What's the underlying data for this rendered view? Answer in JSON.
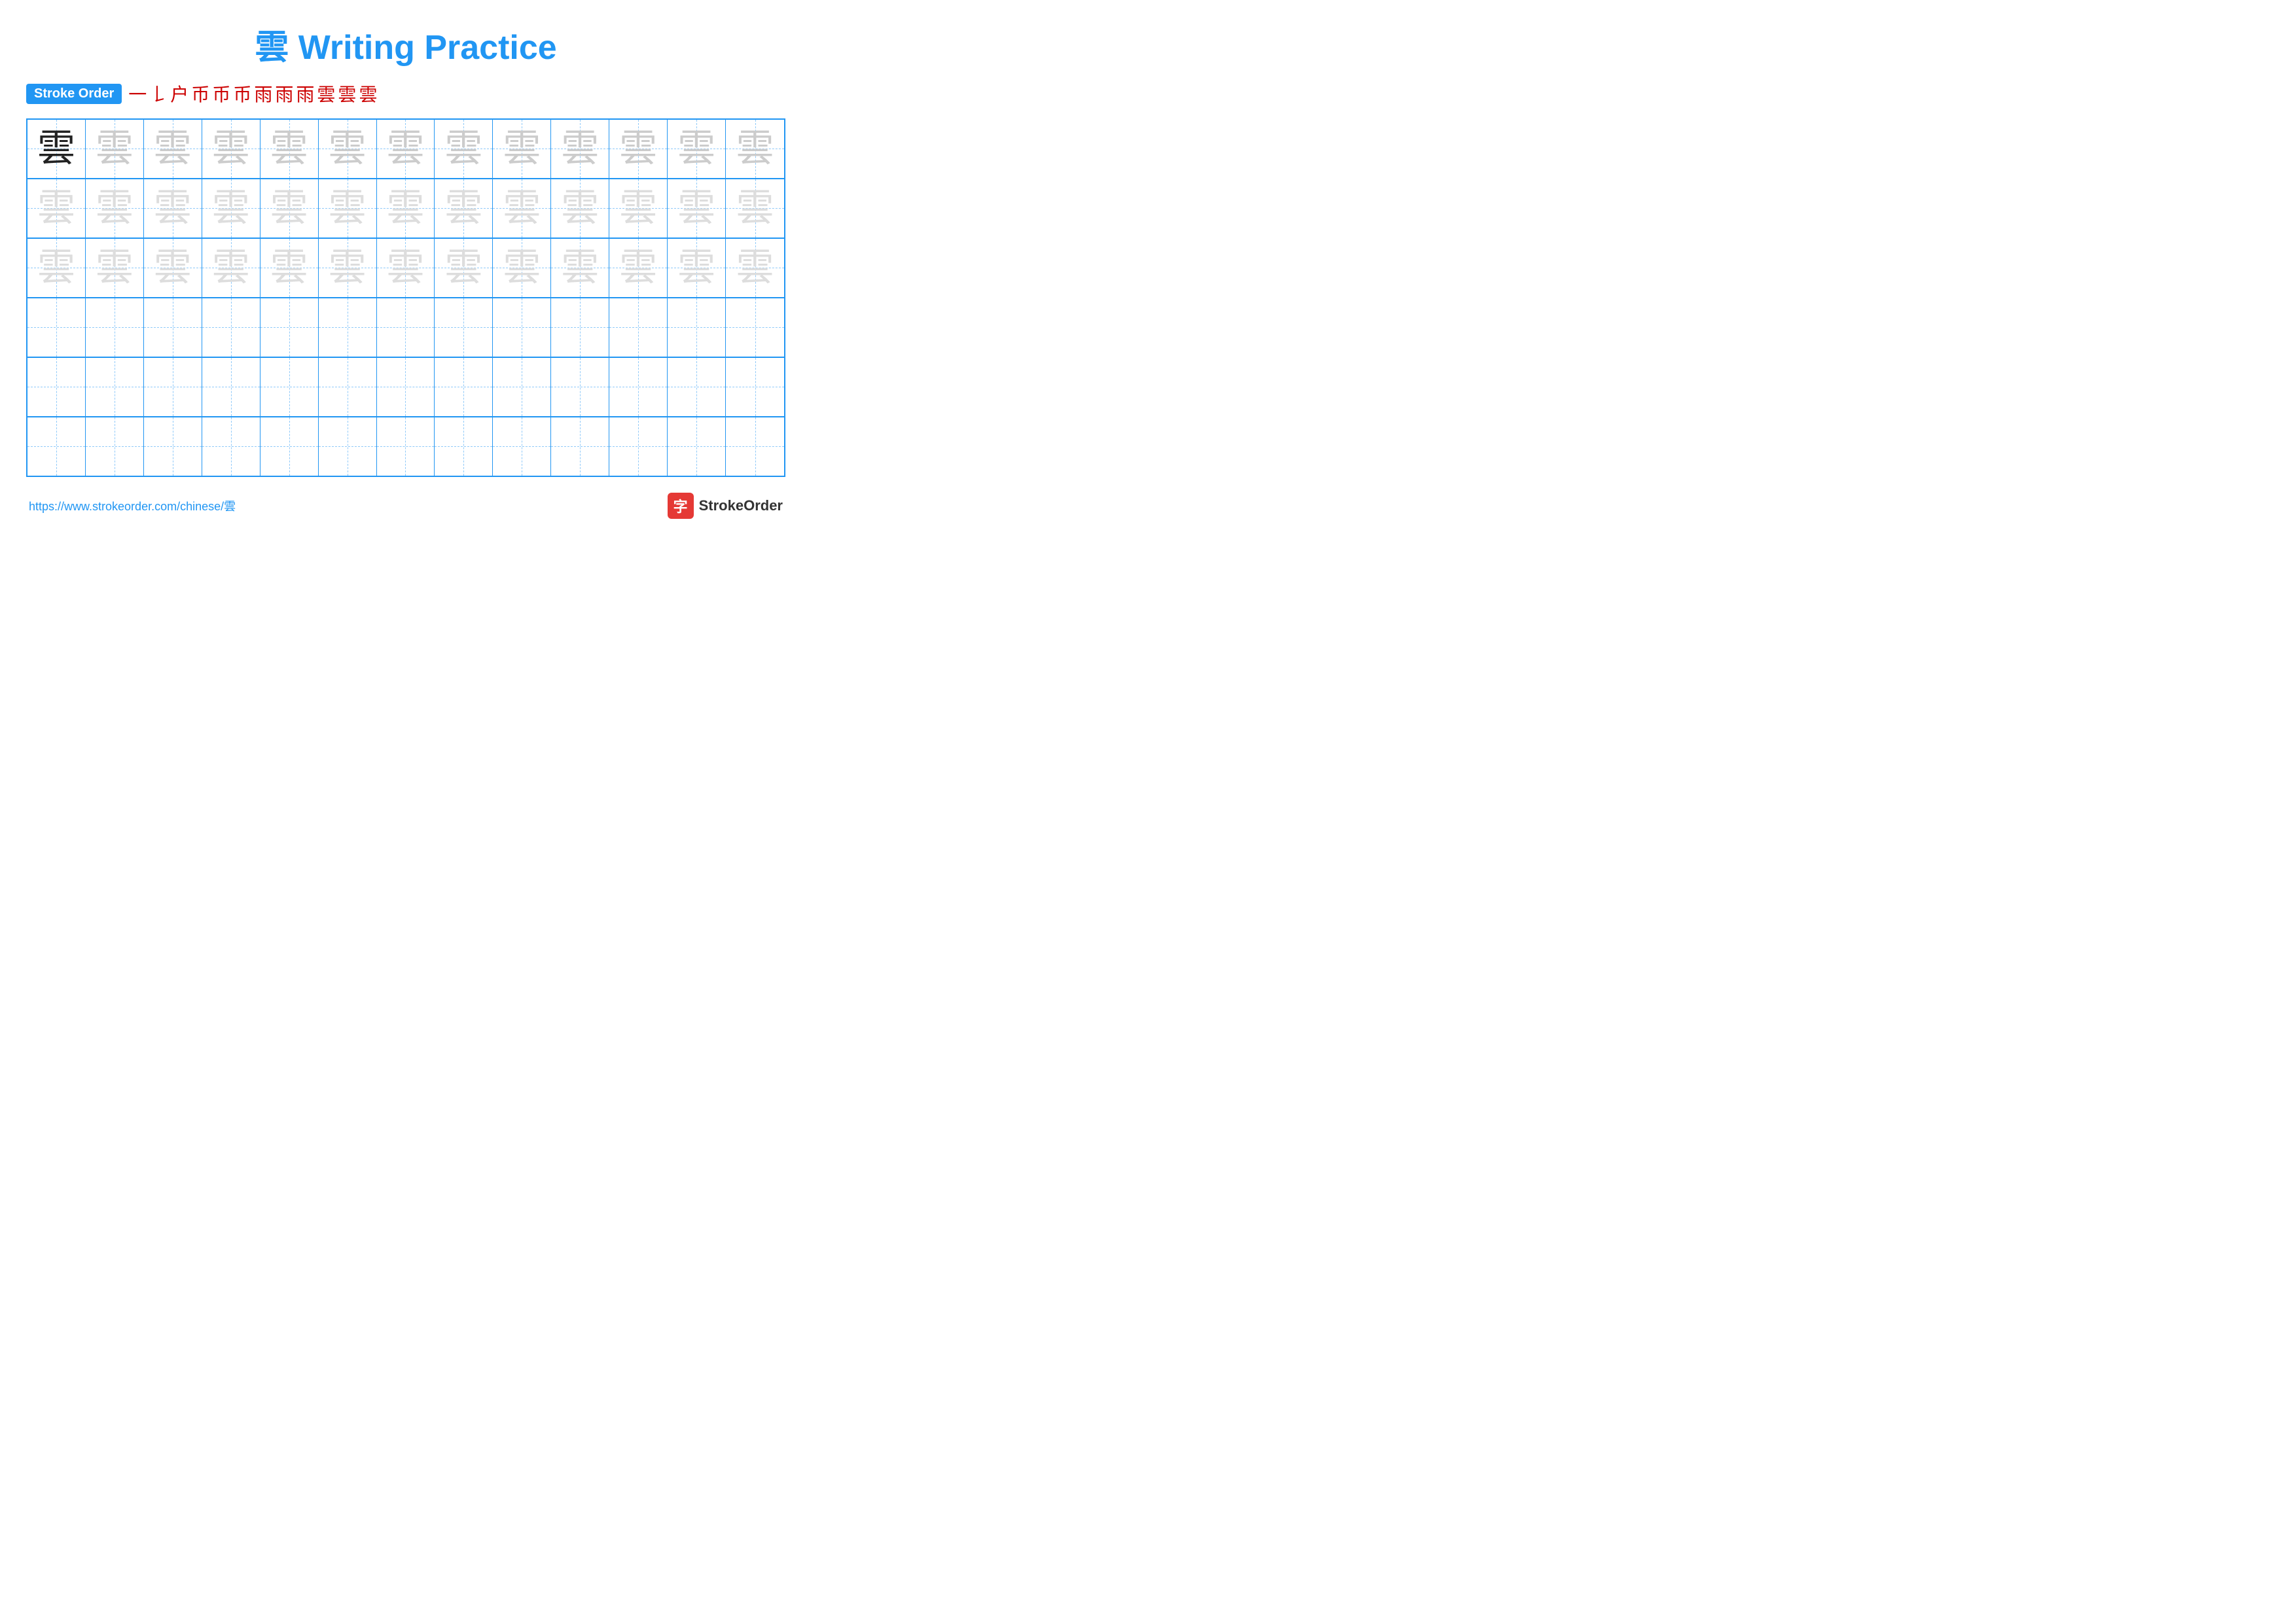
{
  "title": "雲 Writing Practice",
  "stroke_order_label": "Stroke Order",
  "stroke_sequence": [
    "一",
    "𠄌",
    "户",
    "币",
    "币",
    "币",
    "雨",
    "雨",
    "雨",
    "雲",
    "雲",
    "雲"
  ],
  "character": "雲",
  "rows": [
    {
      "type": "solid_then_faint",
      "solid_count": 1,
      "faint_count": 12
    },
    {
      "type": "faint",
      "count": 13
    },
    {
      "type": "faint",
      "count": 13
    },
    {
      "type": "empty",
      "count": 13
    },
    {
      "type": "empty",
      "count": 13
    },
    {
      "type": "empty",
      "count": 13
    }
  ],
  "footer_url": "https://www.strokeorder.com/chinese/雲",
  "brand_icon": "字",
  "brand_name": "StrokeOrder"
}
